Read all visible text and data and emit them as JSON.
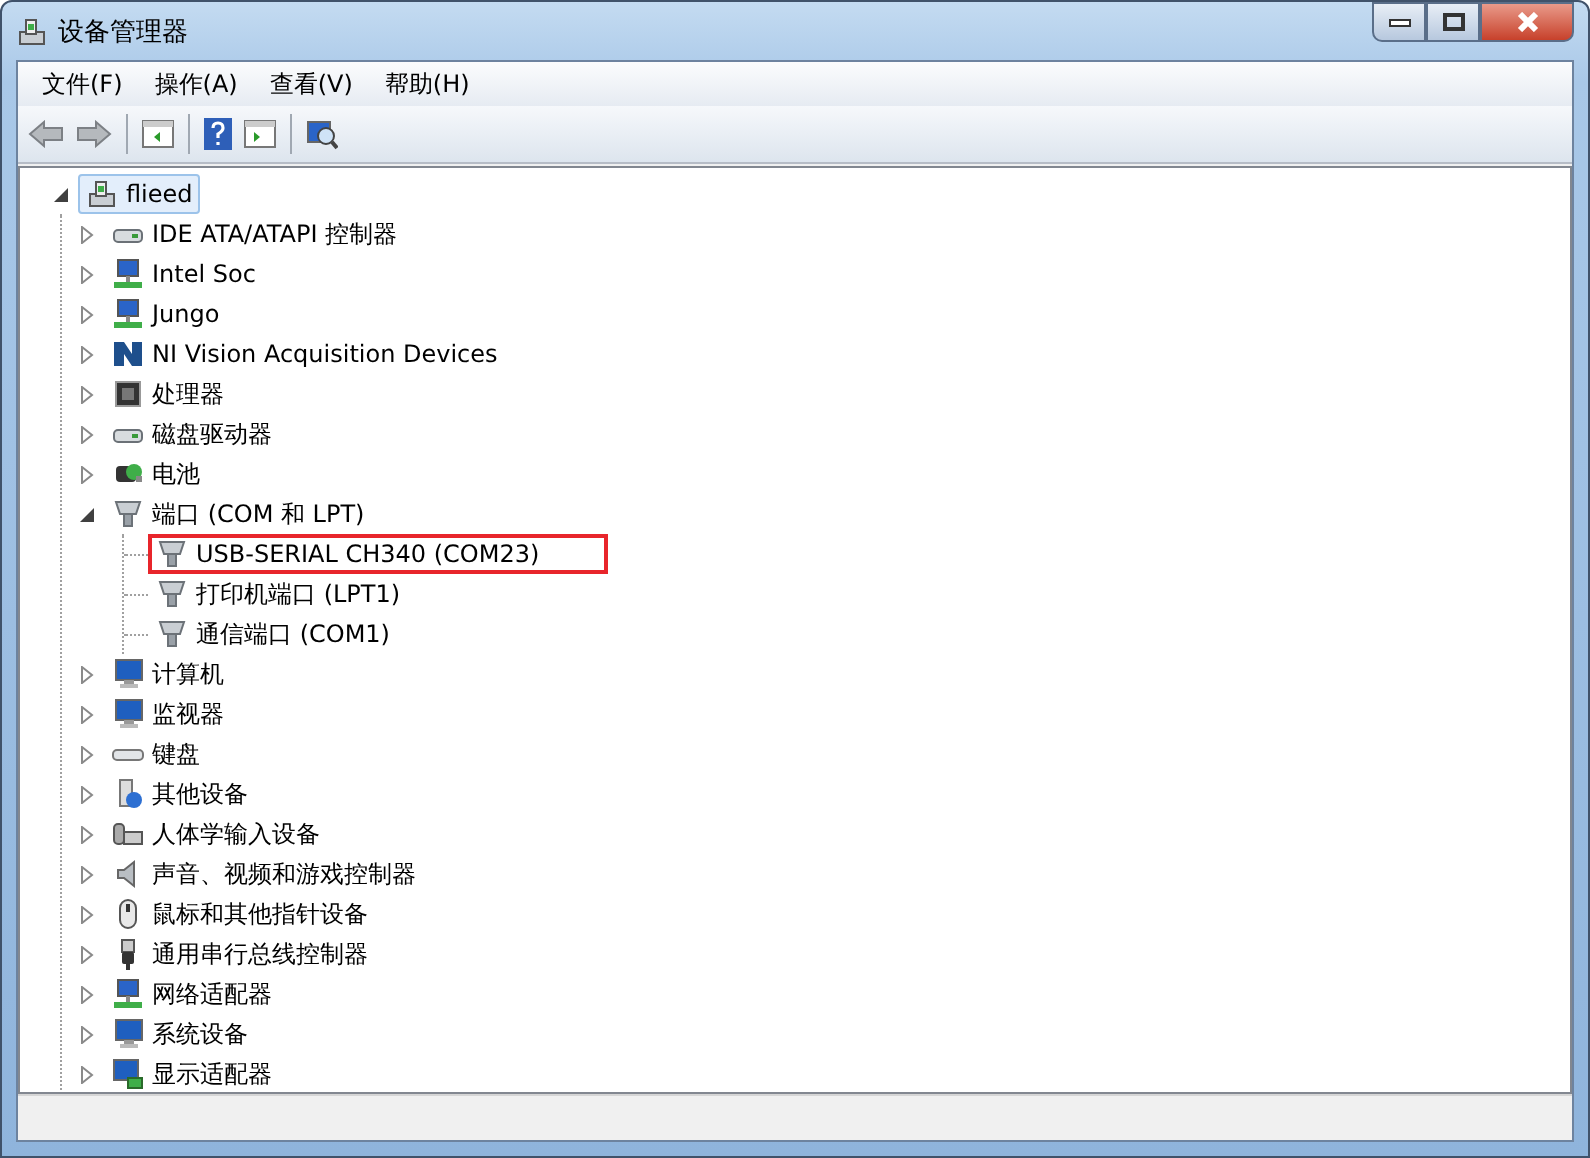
{
  "window": {
    "title": "设备管理器"
  },
  "menu": [
    "文件(F)",
    "操作(A)",
    "查看(V)",
    "帮助(H)"
  ],
  "tree": {
    "label": "flieed",
    "selected": true,
    "expanded": true,
    "children": [
      {
        "label": "IDE ATA/ATAPI 控制器",
        "selected": false,
        "expanded": false
      },
      {
        "label": "Intel Soc",
        "selected": false,
        "expanded": false
      },
      {
        "label": "Jungo",
        "selected": false,
        "expanded": false
      },
      {
        "label": "NI Vision Acquisition Devices",
        "selected": false,
        "expanded": false
      },
      {
        "label": "处理器",
        "selected": false,
        "expanded": false
      },
      {
        "label": "磁盘驱动器",
        "selected": false,
        "expanded": false
      },
      {
        "label": "电池",
        "selected": false,
        "expanded": false
      },
      {
        "label": "端口 (COM 和 LPT)",
        "selected": false,
        "expanded": true,
        "children": [
          {
            "label": "USB-SERIAL CH340 (COM23)",
            "selected": false,
            "annotated": true
          },
          {
            "label": "打印机端口 (LPT1)",
            "selected": false,
            "annotated": false
          },
          {
            "label": "通信端口 (COM1)",
            "selected": false,
            "annotated": false
          }
        ]
      },
      {
        "label": "计算机",
        "selected": false,
        "expanded": false
      },
      {
        "label": "监视器",
        "selected": false,
        "expanded": false
      },
      {
        "label": "键盘",
        "selected": false,
        "expanded": false
      },
      {
        "label": "其他设备",
        "selected": false,
        "expanded": false
      },
      {
        "label": "人体学输入设备",
        "selected": false,
        "expanded": false
      },
      {
        "label": "声音、视频和游戏控制器",
        "selected": false,
        "expanded": false
      },
      {
        "label": "鼠标和其他指针设备",
        "selected": false,
        "expanded": false
      },
      {
        "label": "通用串行总线控制器",
        "selected": false,
        "expanded": false
      },
      {
        "label": "网络适配器",
        "selected": false,
        "expanded": false
      },
      {
        "label": "系统设备",
        "selected": false,
        "expanded": false
      },
      {
        "label": "显示适配器",
        "selected": false,
        "expanded": false
      }
    ]
  }
}
